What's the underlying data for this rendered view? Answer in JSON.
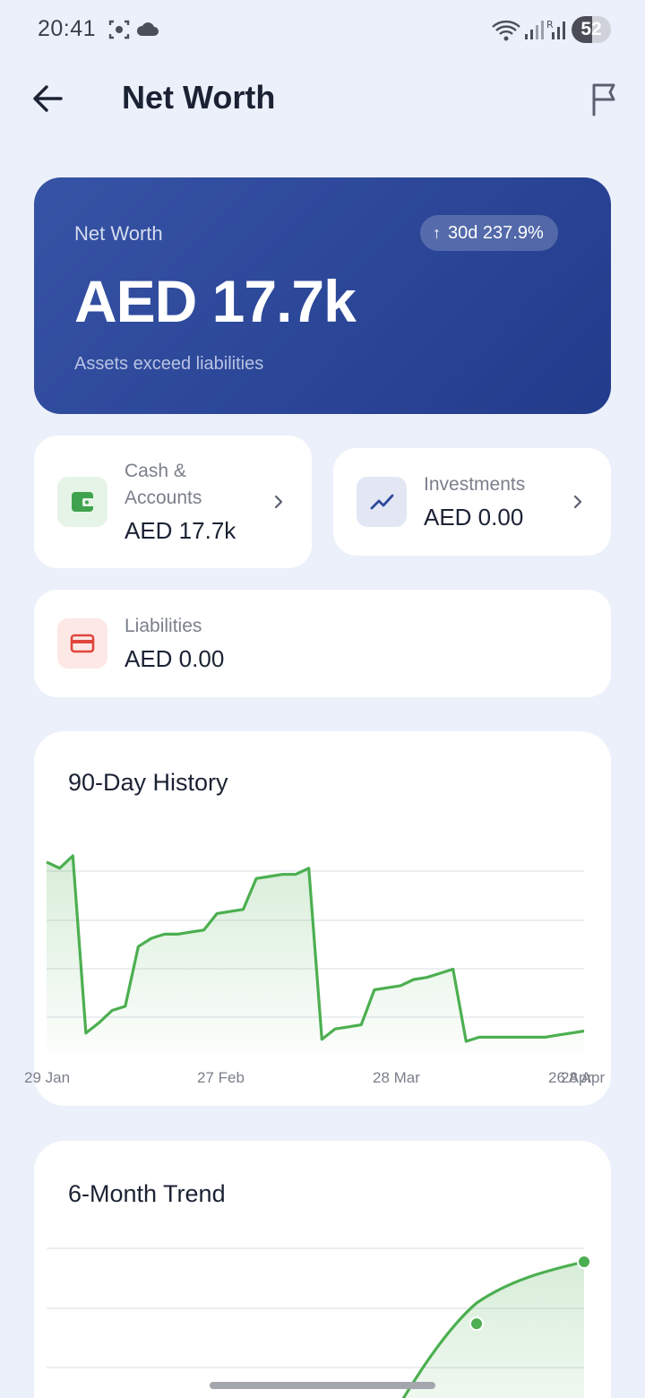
{
  "status_bar": {
    "time": "20:41",
    "battery": "52",
    "battery_level_percent": 52,
    "icons": [
      "screen-record-icon",
      "cloud-icon",
      "wifi-icon",
      "signal-icon",
      "signal-roaming-icon"
    ]
  },
  "header": {
    "title": "Net Worth",
    "back_icon": "arrow-left-icon",
    "action_icon": "flag-icon"
  },
  "hero": {
    "label": "Net Worth",
    "value": "AED 17.7k",
    "subtitle": "Assets exceed liabilities",
    "badge_arrow": "↑",
    "badge_text": "30d 237.9%",
    "gradient_start": "#3753a5",
    "gradient_end": "#223c8c"
  },
  "cards": {
    "cash": {
      "label_line1": "Cash &",
      "label_line2": "Accounts",
      "value": "AED 17.7k",
      "icon": "wallet-icon",
      "icon_color": "#3fa34d",
      "tile_color": "#e6f4e7"
    },
    "investments": {
      "label": "Investments",
      "value": "AED 0.00",
      "icon": "trending-up-icon",
      "icon_color": "#2f4a9a",
      "tile_color": "#e3e7f4"
    },
    "liabilities": {
      "label": "Liabilities",
      "value": "AED 0.00",
      "icon": "credit-card-icon",
      "icon_color": "#e0463c",
      "tile_color": "#fde8e6"
    }
  },
  "chart_data": [
    {
      "type": "area",
      "title": "90-Day History",
      "x_tick_labels": [
        "29 Jan",
        "27 Feb",
        "28 Mar",
        "26 Apr",
        "28 Apr"
      ],
      "grid": true,
      "line_color": "#4caf50",
      "series": [
        {
          "values": [
            0.87,
            0.84,
            0.9,
            0.04,
            0.09,
            0.15,
            0.17,
            0.46,
            0.5,
            0.52,
            0.52,
            0.53,
            0.54,
            0.62,
            0.63,
            0.64,
            0.79,
            0.8,
            0.81,
            0.81,
            0.84,
            0.01,
            0.06,
            0.07,
            0.08,
            0.25,
            0.26,
            0.27,
            0.3,
            0.31,
            0.33,
            0.35,
            0.0,
            0.02,
            0.02,
            0.02,
            0.02,
            0.02,
            0.02,
            0.03,
            0.04,
            0.05
          ]
        }
      ]
    },
    {
      "type": "line",
      "title": "6-Month Trend",
      "grid": true,
      "line_color": "#4caf50",
      "series": [
        {
          "values": [
            0.0,
            0.0,
            0.0,
            0.0,
            0.68,
            1.0
          ]
        }
      ]
    }
  ]
}
